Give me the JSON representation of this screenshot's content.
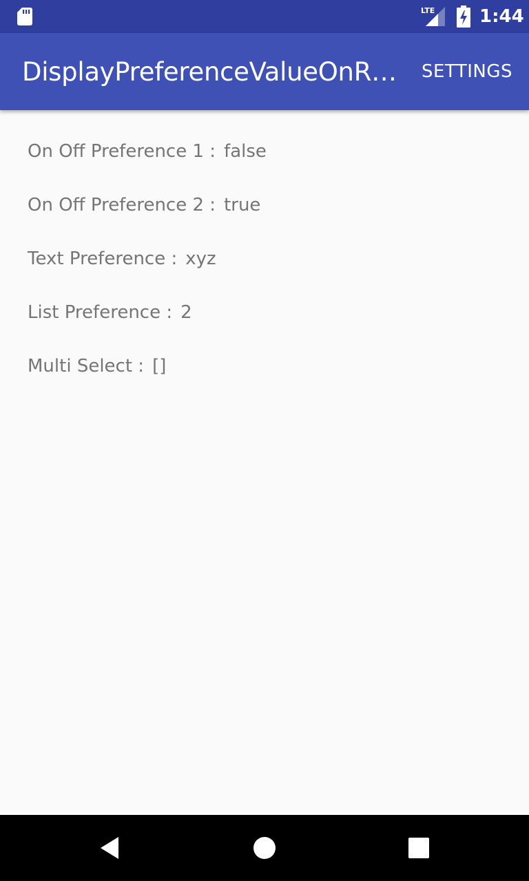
{
  "status_bar": {
    "network": "LTE",
    "time": "1:44",
    "icons": [
      "sd-card-icon",
      "lte-signal-icon",
      "battery-charging-icon"
    ]
  },
  "app_bar": {
    "title": "DisplayPreferenceValueOnRi…",
    "settings_label": "SETTINGS"
  },
  "preferences": [
    {
      "label": "On Off Preference 1 :",
      "value": "false"
    },
    {
      "label": "On Off Preference 2 :",
      "value": "true"
    },
    {
      "label": "Text Preference :",
      "value": "xyz"
    },
    {
      "label": "List Preference :",
      "value": "2"
    },
    {
      "label": "Multi Select :",
      "value": "[]"
    }
  ],
  "nav_bar": {
    "icons": [
      "back-icon",
      "home-icon",
      "recents-icon"
    ]
  },
  "colors": {
    "status_bar": "#303f9f",
    "app_bar": "#3f51b5",
    "text_secondary": "#757575",
    "background": "#fafafa"
  }
}
